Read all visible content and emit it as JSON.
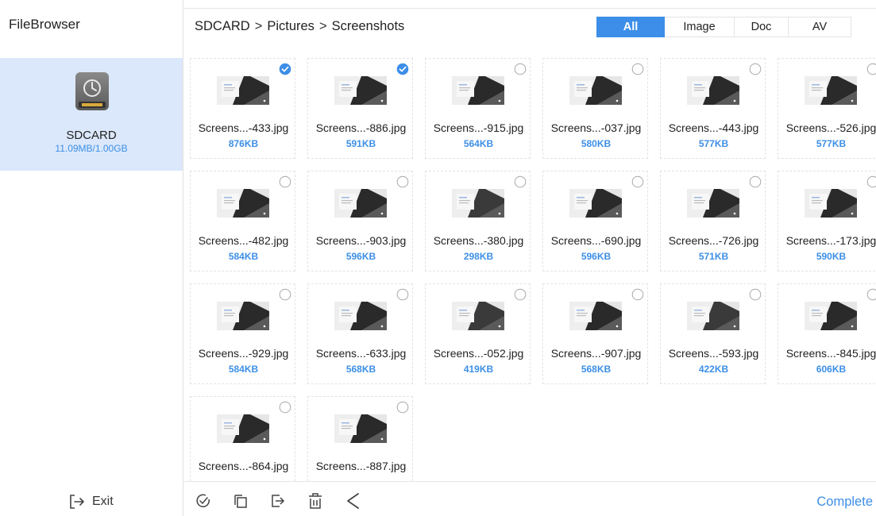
{
  "app": {
    "title": "FileBrowser"
  },
  "sidebar": {
    "drive": {
      "name": "SDCARD",
      "usage": "11.09MB/1.00GB",
      "icon": "sdcard-drive-icon"
    },
    "exit_label": "Exit"
  },
  "header": {
    "breadcrumb": [
      "SDCARD",
      "Pictures",
      "Screenshots"
    ],
    "separator": ">",
    "filters": [
      {
        "label": "All",
        "active": true
      },
      {
        "label": "Image",
        "active": false
      },
      {
        "label": "Doc",
        "active": false
      },
      {
        "label": "AV",
        "active": false
      }
    ]
  },
  "files": [
    {
      "name": "Screens...-433.jpg",
      "size": "876KB",
      "selected": true
    },
    {
      "name": "Screens...-886.jpg",
      "size": "591KB",
      "selected": true
    },
    {
      "name": "Screens...-915.jpg",
      "size": "564KB",
      "selected": false
    },
    {
      "name": "Screens...-037.jpg",
      "size": "580KB",
      "selected": false
    },
    {
      "name": "Screens...-443.jpg",
      "size": "577KB",
      "selected": false
    },
    {
      "name": "Screens...-526.jpg",
      "size": "577KB",
      "selected": false
    },
    {
      "name": "Screens...-482.jpg",
      "size": "584KB",
      "selected": false
    },
    {
      "name": "Screens...-903.jpg",
      "size": "596KB",
      "selected": false
    },
    {
      "name": "Screens...-380.jpg",
      "size": "298KB",
      "selected": false
    },
    {
      "name": "Screens...-690.jpg",
      "size": "596KB",
      "selected": false
    },
    {
      "name": "Screens...-726.jpg",
      "size": "571KB",
      "selected": false
    },
    {
      "name": "Screens...-173.jpg",
      "size": "590KB",
      "selected": false
    },
    {
      "name": "Screens...-929.jpg",
      "size": "584KB",
      "selected": false
    },
    {
      "name": "Screens...-633.jpg",
      "size": "568KB",
      "selected": false
    },
    {
      "name": "Screens...-052.jpg",
      "size": "419KB",
      "selected": false
    },
    {
      "name": "Screens...-907.jpg",
      "size": "568KB",
      "selected": false
    },
    {
      "name": "Screens...-593.jpg",
      "size": "422KB",
      "selected": false
    },
    {
      "name": "Screens...-845.jpg",
      "size": "606KB",
      "selected": false
    },
    {
      "name": "Screens...-864.jpg",
      "size": "",
      "selected": false
    },
    {
      "name": "Screens...-887.jpg",
      "size": "",
      "selected": false
    }
  ],
  "toolbar": {
    "icons": [
      "select-all-icon",
      "copy-icon",
      "move-icon",
      "delete-icon",
      "share-icon"
    ],
    "complete_label": "Complete"
  },
  "colors": {
    "accent": "#3c8ee8",
    "selected_bg": "#dbe8fb",
    "size_text": "#3d8fe6"
  }
}
